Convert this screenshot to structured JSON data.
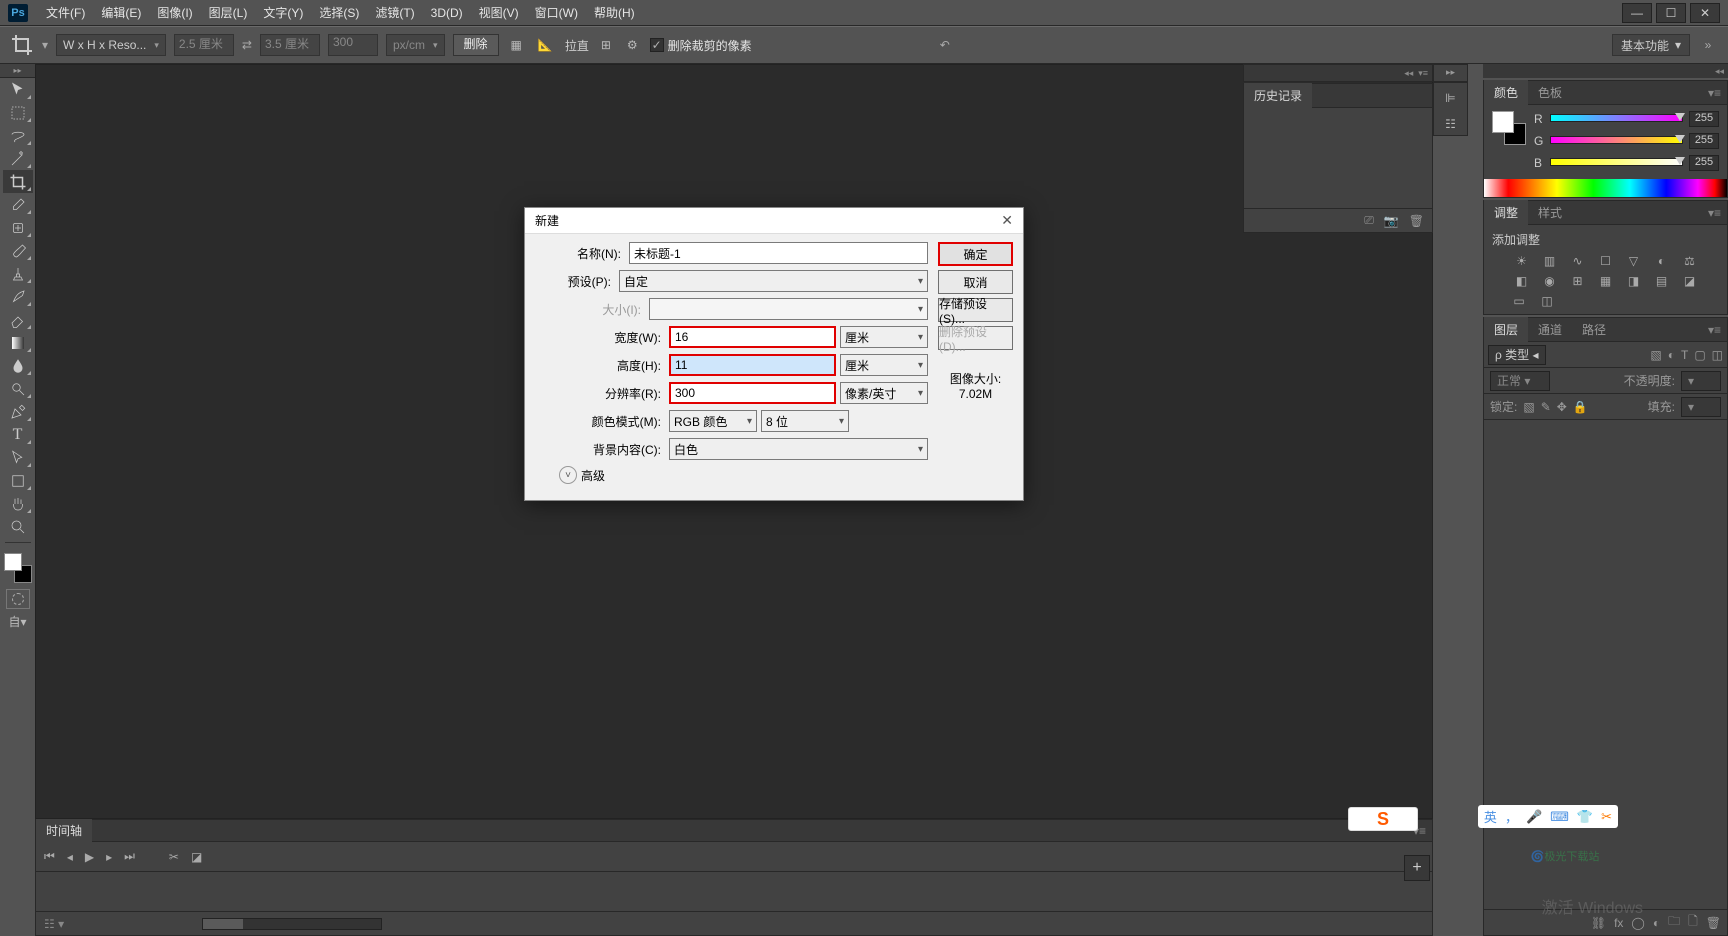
{
  "menubar": {
    "items": [
      "文件(F)",
      "编辑(E)",
      "图像(I)",
      "图层(L)",
      "文字(Y)",
      "选择(S)",
      "滤镜(T)",
      "3D(D)",
      "视图(V)",
      "窗口(W)",
      "帮助(H)"
    ]
  },
  "optionsbar": {
    "preset": "W x H x Reso...",
    "width_val": "2.5 厘米",
    "height_val": "3.5 厘米",
    "res_val": "300",
    "unit": "px/cm",
    "clear": "删除",
    "straighten": "拉直",
    "delete_cropped": "删除裁剪的像素",
    "workspace": "基本功能"
  },
  "history": {
    "tab": "历史记录"
  },
  "color_panel": {
    "tabs": [
      "颜色",
      "色板"
    ],
    "r_label": "R",
    "g_label": "G",
    "b_label": "B",
    "r": "255",
    "g": "255",
    "b": "255"
  },
  "adjust_panel": {
    "tabs": [
      "调整",
      "样式"
    ],
    "add_label": "添加调整"
  },
  "layers_panel": {
    "tabs": [
      "图层",
      "通道",
      "路径"
    ],
    "kind": "ρ 类型",
    "blend": "正常",
    "opacity_label": "不透明度:",
    "lock_label": "锁定:",
    "fill_label": "填充:"
  },
  "timeline": {
    "tab": "时间轴"
  },
  "dialog": {
    "title": "新建",
    "name_label": "名称(N):",
    "name_value": "未标题-1",
    "preset_label": "预设(P):",
    "preset_value": "自定",
    "size_label": "大小(I):",
    "width_label": "宽度(W):",
    "width_value": "16",
    "width_unit": "厘米",
    "height_label": "高度(H):",
    "height_value": "11",
    "height_unit": "厘米",
    "res_label": "分辨率(R):",
    "res_value": "300",
    "res_unit": "像素/英寸",
    "mode_label": "颜色模式(M):",
    "mode_value": "RGB 颜色",
    "depth_value": "8 位",
    "bg_label": "背景内容(C):",
    "bg_value": "白色",
    "advanced": "高级",
    "ok": "确定",
    "cancel": "取消",
    "save_preset": "存储预设(S)...",
    "delete_preset": "删除预设(D)...",
    "imgsize_label": "图像大小:",
    "imgsize_value": "7.02M"
  },
  "langbar": {
    "ime": "英",
    "comma": "，"
  },
  "activate": "激活 Windows"
}
